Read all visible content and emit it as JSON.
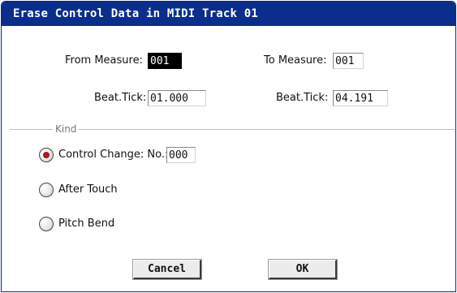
{
  "dialog": {
    "title": "Erase Control Data in MIDI Track 01",
    "from_measure_label": "From Measure:",
    "from_measure_value": "001",
    "to_measure_label": "To Measure:",
    "to_measure_value": "001",
    "from_beat_tick_label": "Beat.Tick:",
    "from_beat_tick_value": "01.000",
    "to_beat_tick_label": "Beat.Tick:",
    "to_beat_tick_value": "04.191",
    "kind_group_label": "Kind",
    "options": [
      {
        "label": "Control Change: No.:",
        "selected": true
      },
      {
        "label": "After Touch",
        "selected": false
      },
      {
        "label": "Pitch Bend",
        "selected": false
      }
    ],
    "control_change_number": "000",
    "cancel_label": "Cancel",
    "ok_label": "OK"
  },
  "colors": {
    "title_bar": "#0b2d8c",
    "title_text": "#ffffff",
    "radio_selected": "#b3161c",
    "selected_field": "#000000"
  }
}
